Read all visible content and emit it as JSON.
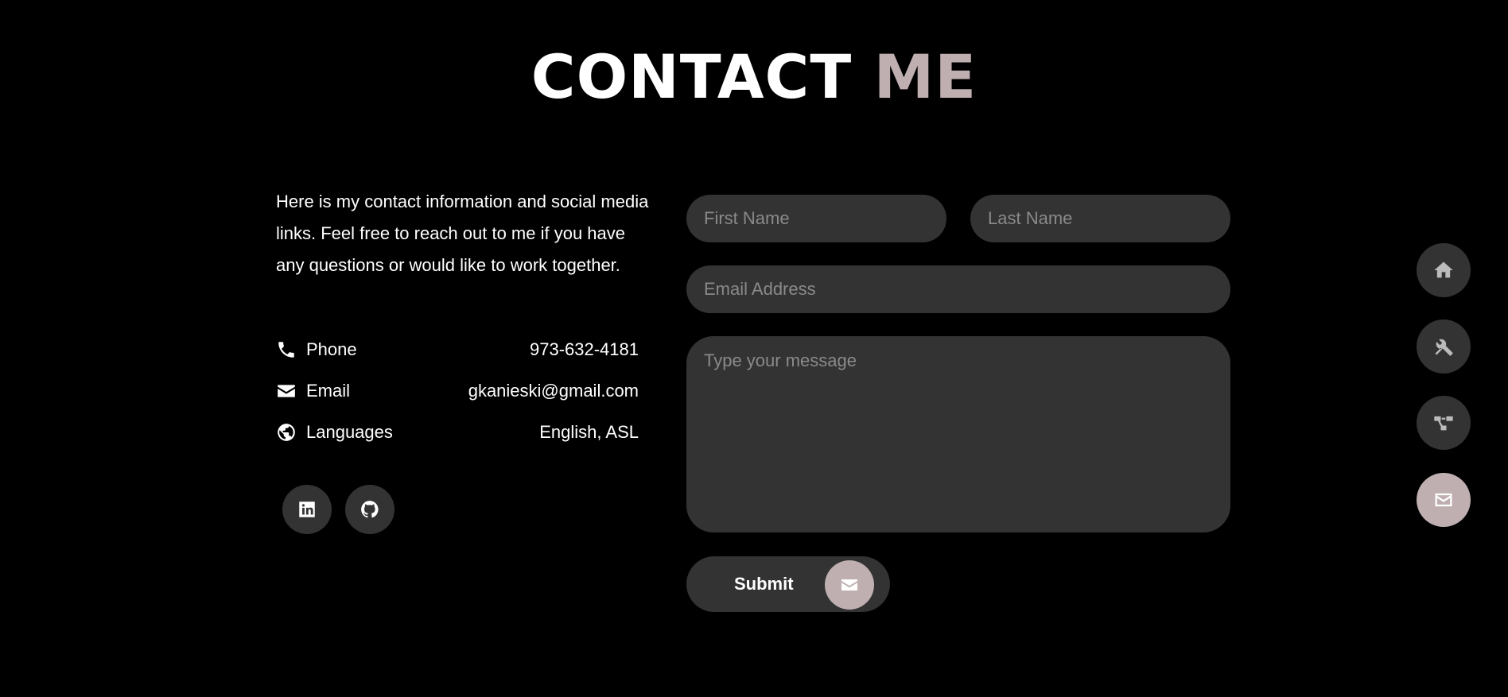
{
  "title": {
    "main": "CONTACT",
    "accent": "ME"
  },
  "intro": "Here is my contact information and social media links. Feel free to reach out to me if you have any questions or would like to work together.",
  "contact_info": [
    {
      "label": "Phone",
      "value": "973-632-4181",
      "icon": "phone-icon"
    },
    {
      "label": "Email",
      "value": "gkanieski@gmail.com",
      "icon": "envelope-icon"
    },
    {
      "label": "Languages",
      "value": "English, ASL",
      "icon": "globe-icon"
    }
  ],
  "social": [
    {
      "name": "linkedin-icon"
    },
    {
      "name": "github-icon"
    }
  ],
  "form": {
    "first_name_placeholder": "First Name",
    "last_name_placeholder": "Last Name",
    "email_placeholder": "Email Address",
    "message_placeholder": "Type your message",
    "submit_label": "Submit"
  },
  "nav": [
    {
      "name": "home-icon",
      "active": false
    },
    {
      "name": "tools-icon",
      "active": false
    },
    {
      "name": "project-diagram-icon",
      "active": false
    },
    {
      "name": "envelope-icon",
      "active": true
    }
  ],
  "colors": {
    "accent": "#bfafb1",
    "background": "#000000",
    "surface": "#333333",
    "placeholder": "#8a8a8a"
  }
}
